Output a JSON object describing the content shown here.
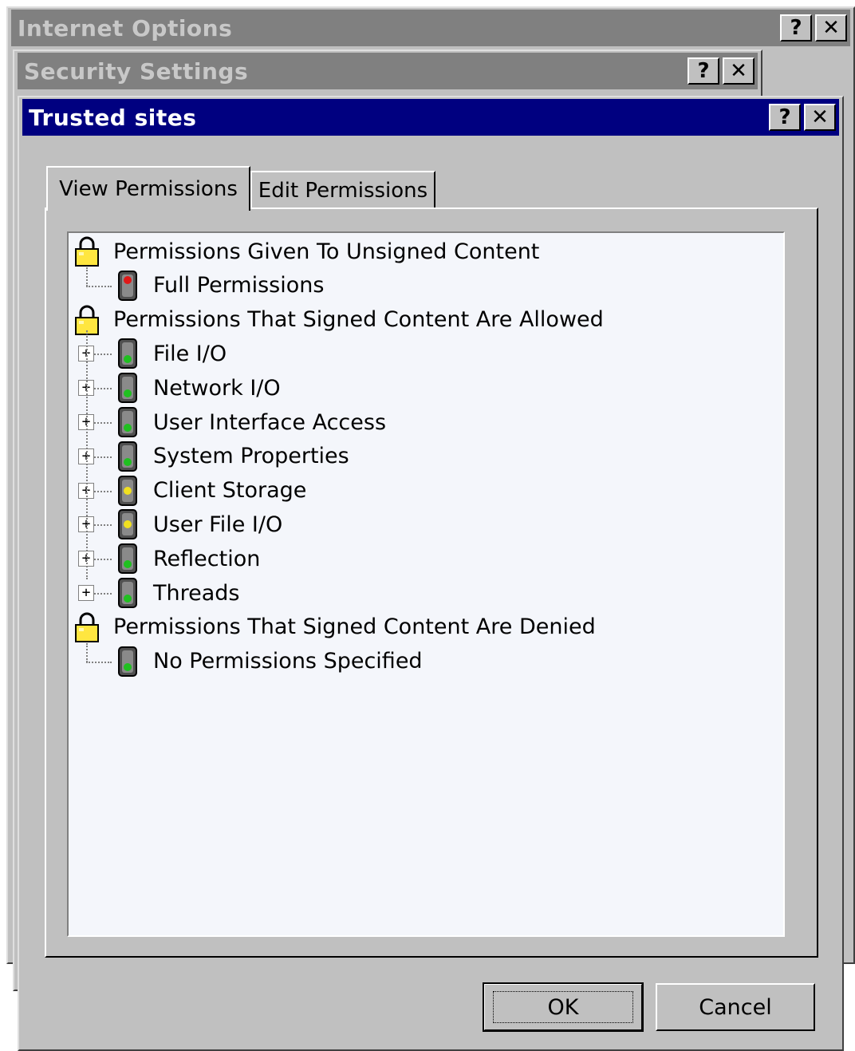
{
  "windows": {
    "internet_options": {
      "title": "Internet Options",
      "help": "?",
      "close": "✕"
    },
    "security_settings": {
      "title": "Security Settings",
      "help": "?",
      "close": "✕"
    },
    "trusted_sites": {
      "title": "Trusted sites",
      "help": "?",
      "close": "✕"
    }
  },
  "tabs": [
    {
      "label": "View Permissions",
      "selected": true
    },
    {
      "label": "Edit Permissions",
      "selected": false
    }
  ],
  "tree": {
    "items": [
      {
        "label": "Permissions Given To Unsigned Content",
        "icon": "lock-icon",
        "kind": "group"
      },
      {
        "label": "Full Permissions",
        "icon": "red-light-icon",
        "light": "red",
        "kind": "leaf"
      },
      {
        "label": "Permissions That Signed Content Are Allowed",
        "icon": "lock-icon",
        "kind": "group"
      },
      {
        "label": "File I/O",
        "icon": "green-light-icon",
        "light": "green",
        "kind": "expandable",
        "expander": "+"
      },
      {
        "label": "Network I/O",
        "icon": "green-light-icon",
        "light": "green",
        "kind": "expandable",
        "expander": "+"
      },
      {
        "label": "User Interface Access",
        "icon": "green-light-icon",
        "light": "green",
        "kind": "expandable",
        "expander": "+"
      },
      {
        "label": "System Properties",
        "icon": "green-light-icon",
        "light": "green",
        "kind": "expandable",
        "expander": "+"
      },
      {
        "label": "Client Storage",
        "icon": "yellow-light-icon",
        "light": "yellow",
        "kind": "expandable",
        "expander": "+"
      },
      {
        "label": "User File I/O",
        "icon": "yellow-light-icon",
        "light": "yellow",
        "kind": "expandable",
        "expander": "+"
      },
      {
        "label": "Reflection",
        "icon": "green-light-icon",
        "light": "green",
        "kind": "expandable",
        "expander": "+"
      },
      {
        "label": "Threads",
        "icon": "green-light-icon",
        "light": "green",
        "kind": "expandable",
        "expander": "+"
      },
      {
        "label": "Permissions That Signed Content Are Denied",
        "icon": "lock-icon",
        "kind": "group"
      },
      {
        "label": "No Permissions Specified",
        "icon": "green-light-icon",
        "light": "green",
        "kind": "leaf"
      }
    ]
  },
  "buttons": {
    "ok": "OK",
    "cancel": "Cancel"
  },
  "colors": {
    "active_title": "#000080",
    "inactive_title": "#808080",
    "face": "#c0c0c0"
  }
}
